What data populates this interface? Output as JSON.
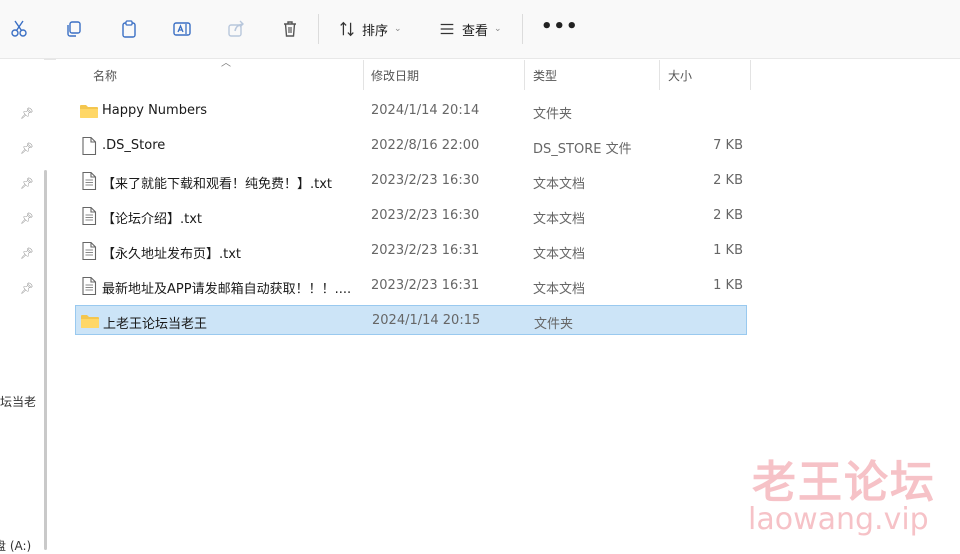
{
  "toolbar": {
    "sort_label": "排序",
    "view_label": "查看",
    "more_label": "•••"
  },
  "nav": {
    "partial_label_1": "坛当老",
    "partial_label_2": "盘 (A:)"
  },
  "columns": {
    "name": "名称",
    "date": "修改日期",
    "type": "类型",
    "size": "大小"
  },
  "files": [
    {
      "name": "Happy Numbers",
      "date": "2024/1/14 20:14",
      "type": "文件夹",
      "size": "",
      "icon": "folder-icon"
    },
    {
      "name": ".DS_Store",
      "date": "2022/8/16 22:00",
      "type": "DS_STORE 文件",
      "size": "7 KB",
      "icon": "file-icon"
    },
    {
      "name": "【来了就能下载和观看！纯免费！】.txt",
      "date": "2023/2/23 16:30",
      "type": "文本文档",
      "size": "2 KB",
      "icon": "text-file-icon"
    },
    {
      "name": "【论坛介绍】.txt",
      "date": "2023/2/23 16:30",
      "type": "文本文档",
      "size": "2 KB",
      "icon": "text-file-icon"
    },
    {
      "name": "【永久地址发布页】.txt",
      "date": "2023/2/23 16:31",
      "type": "文本文档",
      "size": "1 KB",
      "icon": "text-file-icon"
    },
    {
      "name": "最新地址及APP请发邮箱自动获取！！！....",
      "date": "2023/2/23 16:31",
      "type": "文本文档",
      "size": "1 KB",
      "icon": "text-file-icon"
    },
    {
      "name": "上老王论坛当老王",
      "date": "2024/1/14 20:15",
      "type": "文件夹",
      "size": "",
      "icon": "folder-icon"
    }
  ],
  "selected_index": 6,
  "watermark": {
    "line1": "老王论坛",
    "line2": "laowang.vip"
  },
  "colors": {
    "selection": "#cce4f7",
    "folder": "#f4c64e",
    "watermark": "#ec7882"
  }
}
